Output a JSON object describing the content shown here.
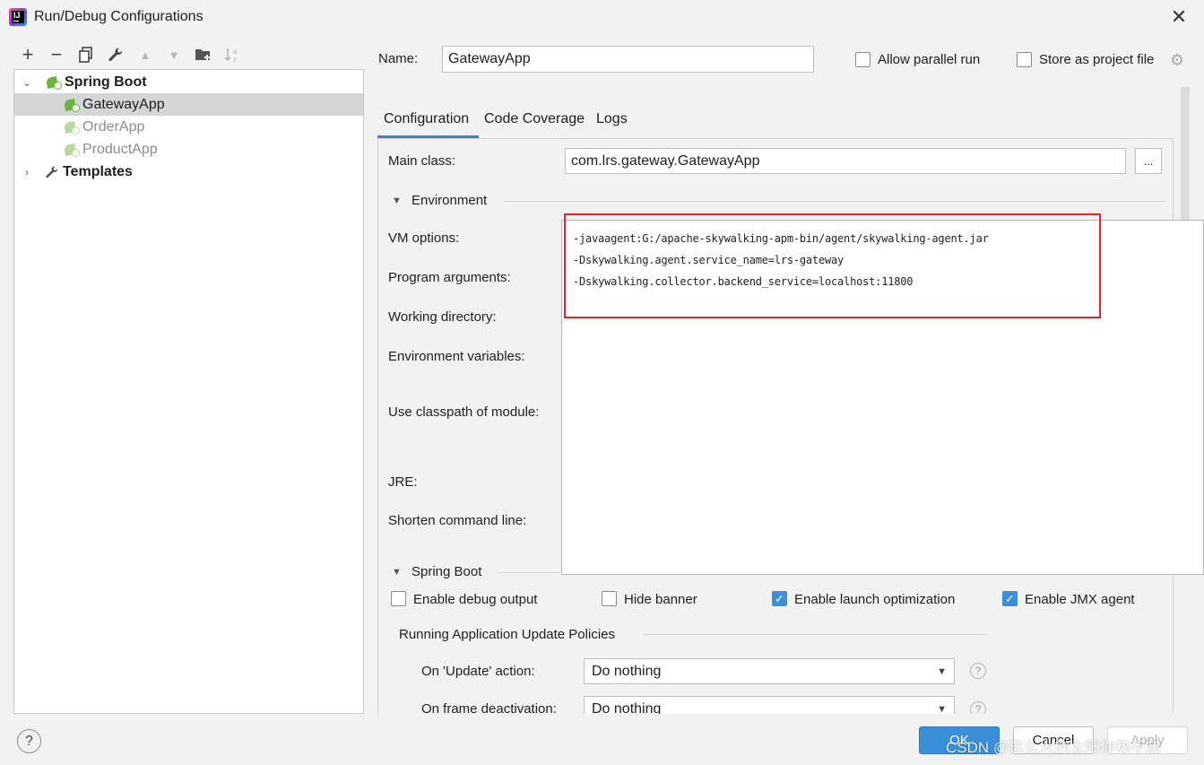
{
  "window": {
    "title": "Run/Debug Configurations",
    "close_glyph": "✕"
  },
  "toolbar": {
    "add": "+",
    "remove": "−",
    "copy": "⧉",
    "edit": "🔧",
    "up": "▲",
    "down": "▼",
    "folder": "📁",
    "sort": "↓a z"
  },
  "tree": {
    "spring_boot": "Spring Boot",
    "items": [
      "GatewayApp",
      "OrderApp",
      "ProductApp"
    ],
    "templates": "Templates"
  },
  "name_row": {
    "label": "Name:",
    "value": "GatewayApp"
  },
  "options": {
    "allow_parallel_run": "Allow parallel run",
    "store_as_project_file": "Store as project file"
  },
  "tabs": [
    "Configuration",
    "Code Coverage",
    "Logs"
  ],
  "form": {
    "main_class_label": "Main class:",
    "main_class_value": "com.lrs.gateway.GatewayApp",
    "browse_label": "...",
    "environment_section": "Environment",
    "vm_options_label": "VM options:",
    "program_arguments_label": "Program arguments:",
    "working_directory_label": "Working directory:",
    "environment_variables_label": "Environment variables:",
    "use_classpath_label": "Use classpath of module:",
    "jre_label": "JRE:",
    "shorten_command_line_label": "Shorten command line:"
  },
  "vm_options_lines": [
    "-javaagent:G:/apache-skywalking-apm-bin/agent/skywalking-agent.jar",
    "-Dskywalking.agent.service_name=lrs-gateway",
    "-Dskywalking.collector.backend_service=localhost:11800"
  ],
  "spring_boot_section": {
    "title": "Spring Boot",
    "enable_debug_output": "Enable debug output",
    "hide_banner": "Hide banner",
    "enable_launch_optimization": "Enable launch optimization",
    "enable_jmx_agent": "Enable JMX agent",
    "checked": {
      "debug": false,
      "banner": false,
      "launch": true,
      "jmx": true
    },
    "update_policies_title": "Running Application Update Policies",
    "on_update_label": "On 'Update' action:",
    "on_update_value": "Do nothing",
    "on_frame_label": "On frame deactivation:",
    "on_frame_value": "Do nothing"
  },
  "buttons": {
    "help": "?",
    "ok": "OK",
    "cancel": "Cancel",
    "apply": "Apply"
  },
  "watermark": "CSDN @这么大的太阳你热不热",
  "colors": {
    "accent": "#3d84c7",
    "highlight_box": "#e8232d",
    "spring_green": "#6db33f",
    "ok_button": "#3b8fd8"
  }
}
